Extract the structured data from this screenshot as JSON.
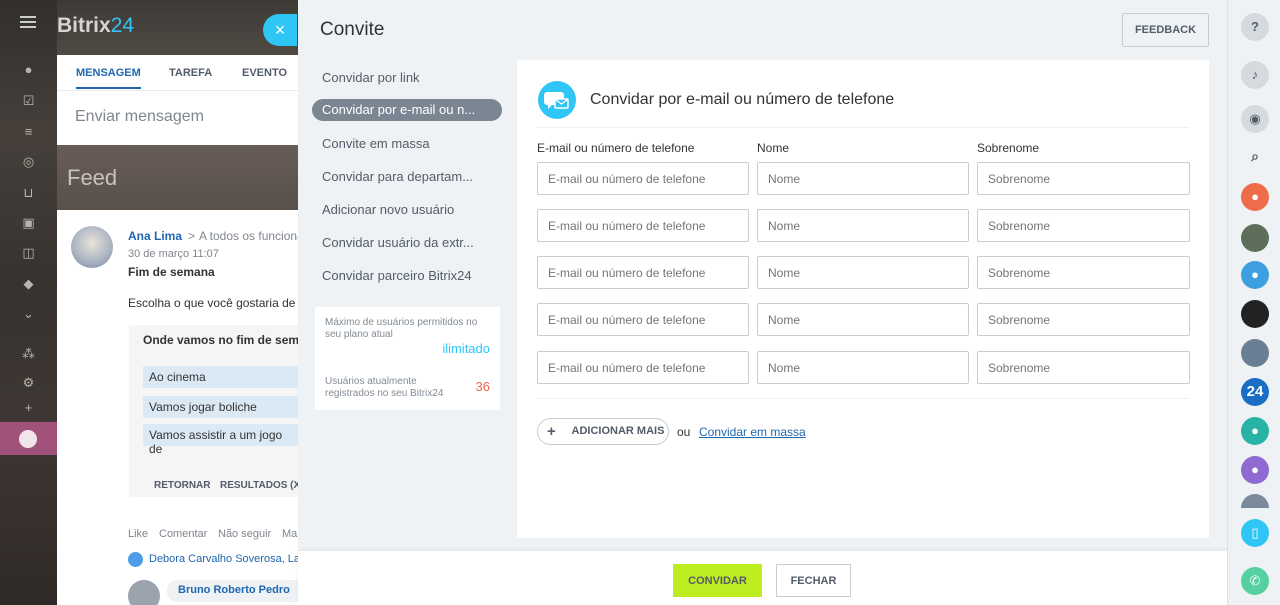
{
  "background": {
    "logo_main": "Bitrix",
    "logo_accent": "24",
    "composer_tabs": [
      "MENSAGEM",
      "TAREFA",
      "EVENTO"
    ],
    "composer_placeholder": "Enviar mensagem",
    "feed_title": "Feed",
    "post": {
      "author": "Ana Lima",
      "recipients": "A todos os funciona",
      "date": "30 de março 11:07",
      "title": "Fim de semana",
      "body": "Escolha o que você gostaria de f",
      "poll_question": "Onde vamos no fim de sema",
      "poll_options": [
        "Ao cinema",
        "Vamos jogar boliche",
        "Vamos assistir a um jogo de"
      ],
      "poll_actions": [
        "RETORNAR",
        "RESULTADOS (X"
      ],
      "actions": [
        "Like",
        "Comentar",
        "Não seguir",
        "Ma"
      ],
      "likes": "Debora Carvalho Soverosa, La",
      "comment_author": "Bruno Roberto Pedro"
    }
  },
  "slider": {
    "title": "Convite",
    "feedback_label": "FEEDBACK",
    "menu": [
      {
        "label": "Convidar por link",
        "active": false
      },
      {
        "label": "Convidar por e-mail ou n...",
        "active": true
      },
      {
        "label": "Convite em massa",
        "active": false
      },
      {
        "label": "Convidar para departam...",
        "active": false
      },
      {
        "label": "Adicionar novo usuário",
        "active": false
      },
      {
        "label": "Convidar usuário da extr...",
        "active": false
      },
      {
        "label": "Convidar parceiro Bitrix24",
        "active": false
      }
    ],
    "limits": {
      "max_label": "Máximo de usuários permitidos no seu plano atual",
      "max_value": "ilimitado",
      "registered_label": "Usuários atualmente registrados no seu Bitrix24",
      "registered_value": "36"
    },
    "card": {
      "title": "Convidar por e-mail ou número de telefone",
      "columns": [
        "E-mail ou número de telefone",
        "Nome",
        "Sobrenome"
      ],
      "placeholders": {
        "email": "E-mail ou número de telefone",
        "first_name": "Nome",
        "last_name": "Sobrenome"
      },
      "row_count": 5,
      "add_more_label": "ADICIONAR MAIS",
      "or_text": "ou",
      "mass_link": "Convidar em massa"
    },
    "footer": {
      "invite_label": "CONVIDAR",
      "close_label": "FECHAR"
    }
  },
  "rightbar": {
    "items": [
      "help-icon",
      "bell-icon",
      "chat-icon",
      "search-icon",
      "group-icon",
      "avatar",
      "group-icon",
      "avatar",
      "avatar",
      "bitrix24-icon",
      "group-icon",
      "group-icon",
      "avatar",
      "mobile-icon",
      "phone-icon"
    ],
    "b24_label": "24"
  },
  "colors": {
    "accent": "#2fc6f6",
    "invite_button": "#bbed21",
    "registered_count": "#f0614e",
    "active_menu": "#7b8692"
  }
}
